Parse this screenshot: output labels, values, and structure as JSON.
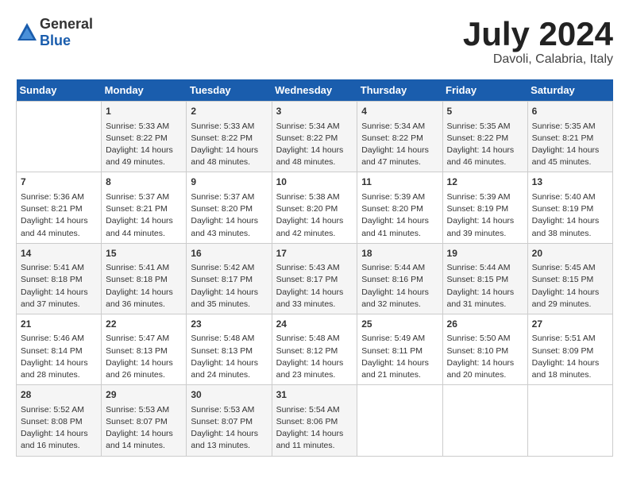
{
  "logo": {
    "general": "General",
    "blue": "Blue"
  },
  "title": "July 2024",
  "subtitle": "Davoli, Calabria, Italy",
  "days_of_week": [
    "Sunday",
    "Monday",
    "Tuesday",
    "Wednesday",
    "Thursday",
    "Friday",
    "Saturday"
  ],
  "weeks": [
    [
      {
        "day": "",
        "info": ""
      },
      {
        "day": "1",
        "info": "Sunrise: 5:33 AM\nSunset: 8:22 PM\nDaylight: 14 hours and 49 minutes."
      },
      {
        "day": "2",
        "info": "Sunrise: 5:33 AM\nSunset: 8:22 PM\nDaylight: 14 hours and 48 minutes."
      },
      {
        "day": "3",
        "info": "Sunrise: 5:34 AM\nSunset: 8:22 PM\nDaylight: 14 hours and 48 minutes."
      },
      {
        "day": "4",
        "info": "Sunrise: 5:34 AM\nSunset: 8:22 PM\nDaylight: 14 hours and 47 minutes."
      },
      {
        "day": "5",
        "info": "Sunrise: 5:35 AM\nSunset: 8:22 PM\nDaylight: 14 hours and 46 minutes."
      },
      {
        "day": "6",
        "info": "Sunrise: 5:35 AM\nSunset: 8:21 PM\nDaylight: 14 hours and 45 minutes."
      }
    ],
    [
      {
        "day": "7",
        "info": "Sunrise: 5:36 AM\nSunset: 8:21 PM\nDaylight: 14 hours and 44 minutes."
      },
      {
        "day": "8",
        "info": "Sunrise: 5:37 AM\nSunset: 8:21 PM\nDaylight: 14 hours and 44 minutes."
      },
      {
        "day": "9",
        "info": "Sunrise: 5:37 AM\nSunset: 8:20 PM\nDaylight: 14 hours and 43 minutes."
      },
      {
        "day": "10",
        "info": "Sunrise: 5:38 AM\nSunset: 8:20 PM\nDaylight: 14 hours and 42 minutes."
      },
      {
        "day": "11",
        "info": "Sunrise: 5:39 AM\nSunset: 8:20 PM\nDaylight: 14 hours and 41 minutes."
      },
      {
        "day": "12",
        "info": "Sunrise: 5:39 AM\nSunset: 8:19 PM\nDaylight: 14 hours and 39 minutes."
      },
      {
        "day": "13",
        "info": "Sunrise: 5:40 AM\nSunset: 8:19 PM\nDaylight: 14 hours and 38 minutes."
      }
    ],
    [
      {
        "day": "14",
        "info": "Sunrise: 5:41 AM\nSunset: 8:18 PM\nDaylight: 14 hours and 37 minutes."
      },
      {
        "day": "15",
        "info": "Sunrise: 5:41 AM\nSunset: 8:18 PM\nDaylight: 14 hours and 36 minutes."
      },
      {
        "day": "16",
        "info": "Sunrise: 5:42 AM\nSunset: 8:17 PM\nDaylight: 14 hours and 35 minutes."
      },
      {
        "day": "17",
        "info": "Sunrise: 5:43 AM\nSunset: 8:17 PM\nDaylight: 14 hours and 33 minutes."
      },
      {
        "day": "18",
        "info": "Sunrise: 5:44 AM\nSunset: 8:16 PM\nDaylight: 14 hours and 32 minutes."
      },
      {
        "day": "19",
        "info": "Sunrise: 5:44 AM\nSunset: 8:15 PM\nDaylight: 14 hours and 31 minutes."
      },
      {
        "day": "20",
        "info": "Sunrise: 5:45 AM\nSunset: 8:15 PM\nDaylight: 14 hours and 29 minutes."
      }
    ],
    [
      {
        "day": "21",
        "info": "Sunrise: 5:46 AM\nSunset: 8:14 PM\nDaylight: 14 hours and 28 minutes."
      },
      {
        "day": "22",
        "info": "Sunrise: 5:47 AM\nSunset: 8:13 PM\nDaylight: 14 hours and 26 minutes."
      },
      {
        "day": "23",
        "info": "Sunrise: 5:48 AM\nSunset: 8:13 PM\nDaylight: 14 hours and 24 minutes."
      },
      {
        "day": "24",
        "info": "Sunrise: 5:48 AM\nSunset: 8:12 PM\nDaylight: 14 hours and 23 minutes."
      },
      {
        "day": "25",
        "info": "Sunrise: 5:49 AM\nSunset: 8:11 PM\nDaylight: 14 hours and 21 minutes."
      },
      {
        "day": "26",
        "info": "Sunrise: 5:50 AM\nSunset: 8:10 PM\nDaylight: 14 hours and 20 minutes."
      },
      {
        "day": "27",
        "info": "Sunrise: 5:51 AM\nSunset: 8:09 PM\nDaylight: 14 hours and 18 minutes."
      }
    ],
    [
      {
        "day": "28",
        "info": "Sunrise: 5:52 AM\nSunset: 8:08 PM\nDaylight: 14 hours and 16 minutes."
      },
      {
        "day": "29",
        "info": "Sunrise: 5:53 AM\nSunset: 8:07 PM\nDaylight: 14 hours and 14 minutes."
      },
      {
        "day": "30",
        "info": "Sunrise: 5:53 AM\nSunset: 8:07 PM\nDaylight: 14 hours and 13 minutes."
      },
      {
        "day": "31",
        "info": "Sunrise: 5:54 AM\nSunset: 8:06 PM\nDaylight: 14 hours and 11 minutes."
      },
      {
        "day": "",
        "info": ""
      },
      {
        "day": "",
        "info": ""
      },
      {
        "day": "",
        "info": ""
      }
    ]
  ]
}
